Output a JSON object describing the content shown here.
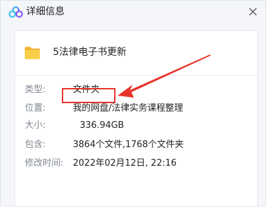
{
  "window": {
    "title": "详细信息",
    "close_label": "×"
  },
  "file": {
    "name": "5法律电子书更新"
  },
  "details": [
    {
      "label": "类型:",
      "value": "文件夹"
    },
    {
      "label": "位置:",
      "value": "我的网盘/法律实务课程整理"
    },
    {
      "label": "大小:",
      "value": "336.94GB"
    },
    {
      "label": "包含:",
      "value": "3864个文件,1768个文件夹"
    },
    {
      "label": "修改时间:",
      "value": "2022年02月12日, 22:16"
    }
  ],
  "colors": {
    "highlight": "#e8332a",
    "folder": "#f7c948",
    "logo": [
      "#3ec1f0",
      "#5b7cf5",
      "#8b5cf6"
    ]
  },
  "icons": {
    "app": "baidu-netdisk-logo-icon",
    "folder": "folder-icon",
    "close": "close-icon"
  }
}
